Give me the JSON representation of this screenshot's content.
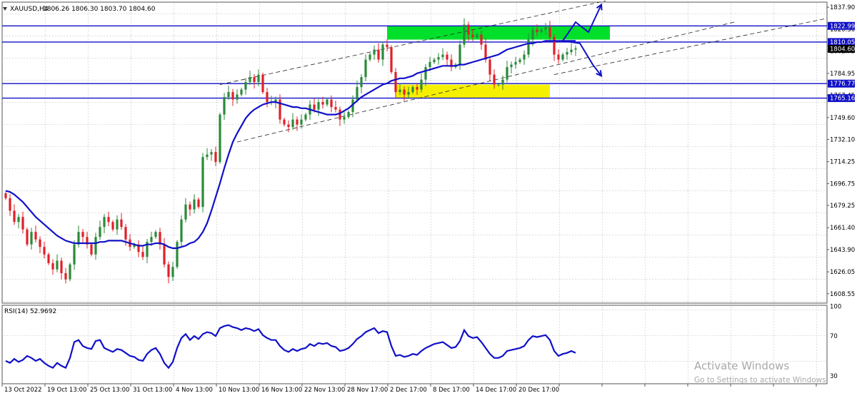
{
  "header": {
    "symbol_tf": "XAUUSD,H4",
    "ohlc": "1806.26 1806.30 1803.70 1804.60"
  },
  "rsi_label": "RSI(14) 52.9692",
  "watermark": {
    "line1": "Activate Windows",
    "line2": "Go to Settings to activate Windows."
  },
  "colors": {
    "bull": "#2a8a3a",
    "bear": "#e0202a",
    "ma": "#1010c8",
    "levels": "#1010c8",
    "rsi": "#1010c8",
    "supply_zone": "#00e02a",
    "demand_zone": "#f5f000",
    "channel": "#222222",
    "arrows": "#1010c8",
    "price_tag_bg": "#1010c8",
    "current_price_bg": "#000000"
  },
  "chart_data": {
    "type": "candlestick",
    "instrument": "XAUUSD",
    "timeframe": "H4",
    "price_ylim": [
      1601,
      1842
    ],
    "rsi_ylim": [
      22,
      101
    ],
    "price_ticks": [
      1837.9,
      1820.3,
      1802.75,
      1784.95,
      1767.45,
      1749.6,
      1732.1,
      1714.25,
      1696.75,
      1679.25,
      1661.4,
      1643.9,
      1626.05,
      1608.55
    ],
    "price_tick_labels": [
      "1837.90",
      "1820.30",
      "1802.75",
      "1784.95",
      "1767.45",
      "1749.60",
      "1732.10",
      "1714.25",
      "1696.75",
      "1679.25",
      "1661.40",
      "1643.90",
      "1626.05",
      "1608.55"
    ],
    "rsi_ticks": [
      100,
      70,
      30
    ],
    "rsi_tick_labels": [
      "100",
      "70",
      "30"
    ],
    "x_labels": [
      "13 Oct 2022",
      "19 Oct 13:00",
      "25 Oct 13:00",
      "31 Oct 13:00",
      "4 Nov 13:00",
      "10 Nov 13:00",
      "16 Nov 13:00",
      "22 Nov 13:00",
      "28 Nov 17:00",
      "2 Dec 17:00",
      "8 Dec 17:00",
      "14 Dec 17:00",
      "20 Dec 17:00"
    ],
    "x_label_bars": [
      0,
      10,
      20,
      30,
      40,
      50,
      60,
      70,
      80,
      90,
      100,
      110,
      120
    ],
    "levels": [
      {
        "price": 1822.99,
        "label": "1822.99"
      },
      {
        "price": 1810.05,
        "label": "1810.05"
      },
      {
        "price": 1776.77,
        "label": "1776.77"
      },
      {
        "price": 1765.16,
        "label": "1765.16"
      }
    ],
    "current_price": {
      "price": 1804.6,
      "label": "1804.60"
    },
    "zones": [
      {
        "name": "supply",
        "bar_start": 89,
        "bar_end": 141,
        "price_low": 1812,
        "price_high": 1823
      },
      {
        "name": "demand",
        "bar_start": 91,
        "bar_end": 127,
        "price_low": 1765,
        "price_high": 1776
      }
    ],
    "channel_lines": [
      {
        "bar_start": 50,
        "price_start": 1776,
        "bar_end": 140,
        "price_end": 1843
      },
      {
        "bar_start": 54,
        "price_start": 1730,
        "bar_end": 170,
        "price_end": 1826
      },
      {
        "bar_start": 128,
        "price_start": 1784,
        "bar_end": 196,
        "price_end": 1829
      }
    ],
    "projections": [
      {
        "name": "bull-path",
        "points": [
          [
            130,
            1811
          ],
          [
            133,
            1826
          ],
          [
            136,
            1818
          ],
          [
            139,
            1840
          ]
        ]
      },
      {
        "name": "bear-path",
        "points": [
          [
            130,
            1811
          ],
          [
            134,
            1809
          ],
          [
            137,
            1792
          ],
          [
            139,
            1783
          ]
        ]
      }
    ],
    "closes": [
      1685,
      1675,
      1666,
      1670,
      1660,
      1648,
      1658,
      1652,
      1646,
      1640,
      1633,
      1628,
      1635,
      1625,
      1620,
      1632,
      1648,
      1658,
      1654,
      1648,
      1640,
      1654,
      1662,
      1670,
      1666,
      1660,
      1668,
      1662,
      1652,
      1646,
      1648,
      1642,
      1638,
      1650,
      1654,
      1658,
      1648,
      1632,
      1622,
      1630,
      1650,
      1668,
      1680,
      1676,
      1684,
      1678,
      1718,
      1720,
      1722,
      1714,
      1752,
      1766,
      1770,
      1764,
      1768,
      1772,
      1778,
      1782,
      1778,
      1784,
      1770,
      1762,
      1762,
      1764,
      1748,
      1744,
      1742,
      1748,
      1744,
      1748,
      1752,
      1760,
      1756,
      1762,
      1760,
      1764,
      1758,
      1756,
      1748,
      1750,
      1754,
      1764,
      1774,
      1782,
      1796,
      1800,
      1804,
      1796,
      1808,
      1806,
      1786,
      1770,
      1772,
      1768,
      1770,
      1774,
      1772,
      1780,
      1790,
      1794,
      1796,
      1798,
      1800,
      1796,
      1790,
      1792,
      1808,
      1824,
      1816,
      1814,
      1816,
      1808,
      1796,
      1784,
      1776,
      1776,
      1780,
      1790,
      1792,
      1794,
      1796,
      1800,
      1812,
      1820,
      1818,
      1820,
      1822,
      1814,
      1800,
      1796,
      1800,
      1802,
      1804,
      1805
    ],
    "ma": [
      1691,
      1690,
      1688,
      1685,
      1682,
      1678,
      1674,
      1670,
      1667,
      1664,
      1661,
      1658,
      1655,
      1653,
      1651,
      1650,
      1649,
      1649,
      1649,
      1649,
      1649,
      1649,
      1650,
      1650,
      1651,
      1651,
      1651,
      1651,
      1650,
      1649,
      1648,
      1647,
      1647,
      1648,
      1648,
      1649,
      1649,
      1648,
      1646,
      1645,
      1645,
      1646,
      1647,
      1649,
      1650,
      1653,
      1658,
      1665,
      1675,
      1686,
      1697,
      1709,
      1720,
      1730,
      1737,
      1743,
      1749,
      1753,
      1756,
      1758,
      1760,
      1761,
      1762,
      1762,
      1761,
      1760,
      1759,
      1758,
      1758,
      1757,
      1757,
      1756,
      1755,
      1754,
      1753,
      1752,
      1752,
      1752,
      1753,
      1755,
      1757,
      1760,
      1763,
      1766,
      1768,
      1770,
      1772,
      1774,
      1776,
      1777,
      1779,
      1780,
      1781,
      1781,
      1782,
      1783,
      1785,
      1786,
      1787,
      1788,
      1789,
      1790,
      1791,
      1791,
      1791,
      1791,
      1792,
      1792,
      1793,
      1794,
      1795,
      1796,
      1797,
      1798,
      1799,
      1800,
      1802,
      1804,
      1805,
      1806,
      1807,
      1808,
      1809,
      1809,
      1810,
      1810,
      1811,
      1811,
      1811,
      1811,
      1811,
      1811,
      1811,
      1811
    ],
    "rsi": [
      45,
      43,
      47,
      44,
      46,
      50,
      48,
      45,
      47,
      43,
      40,
      38,
      43,
      40,
      38,
      48,
      64,
      66,
      60,
      58,
      57,
      65,
      66,
      58,
      56,
      54,
      57,
      56,
      53,
      50,
      49,
      46,
      45,
      52,
      56,
      58,
      52,
      43,
      38,
      44,
      58,
      68,
      72,
      66,
      70,
      67,
      72,
      74,
      73,
      70,
      78,
      80,
      81,
      79,
      78,
      76,
      78,
      77,
      75,
      77,
      71,
      68,
      66,
      66,
      60,
      56,
      54,
      57,
      55,
      57,
      58,
      62,
      60,
      63,
      62,
      63,
      60,
      59,
      55,
      56,
      58,
      62,
      67,
      70,
      74,
      76,
      78,
      73,
      75,
      74,
      60,
      50,
      51,
      49,
      50,
      52,
      51,
      55,
      58,
      60,
      62,
      63,
      64,
      61,
      58,
      59,
      65,
      76,
      70,
      68,
      69,
      64,
      58,
      52,
      48,
      48,
      50,
      55,
      56,
      57,
      58,
      60,
      66,
      70,
      69,
      70,
      71,
      66,
      55,
      50,
      52,
      53,
      55,
      53
    ]
  }
}
